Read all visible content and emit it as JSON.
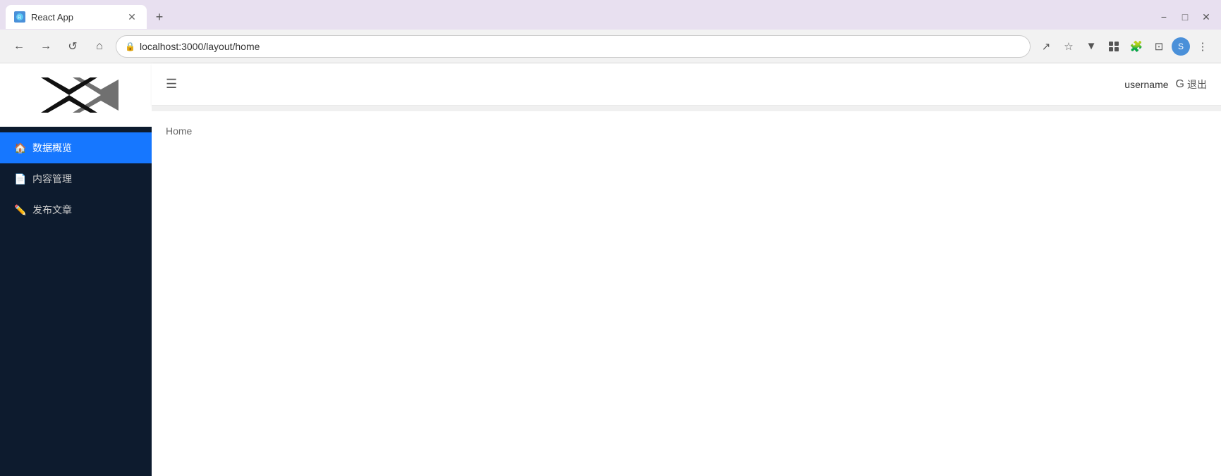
{
  "browser": {
    "tab_title": "React App",
    "tab_favicon": "R",
    "address": "localhost:3000/layout/home",
    "new_tab_label": "+",
    "win_minimize": "−",
    "win_restore": "❐",
    "win_close": "✕",
    "win_maximize": "□"
  },
  "toolbar": {
    "back_label": "←",
    "forward_label": "→",
    "reload_label": "↺",
    "home_label": "⌂",
    "share_label": "↗",
    "star_label": "☆",
    "filter_label": "▼",
    "extensions_label": "⧉",
    "puzzle_label": "🧩",
    "sidebar_label": "⊡",
    "menu_label": "⋮"
  },
  "sidebar": {
    "logo_alt": "Logo",
    "nav_items": [
      {
        "id": "data-overview",
        "label": "数据概览",
        "icon": "🏠",
        "active": true
      },
      {
        "id": "content-management",
        "label": "内容管理",
        "icon": "📄",
        "active": false
      },
      {
        "id": "publish-article",
        "label": "发布文章",
        "icon": "✏️",
        "active": false
      }
    ]
  },
  "header": {
    "menu_toggle_label": "☰",
    "username": "username",
    "logout_label": "退出",
    "logout_icon": "G"
  },
  "content": {
    "breadcrumb": "Home"
  }
}
